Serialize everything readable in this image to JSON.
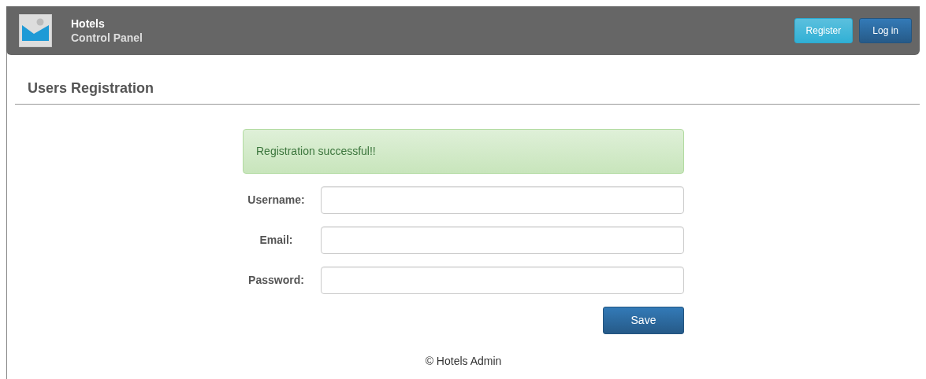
{
  "header": {
    "title": "Hotels",
    "subtitle": "Control Panel",
    "buttons": [
      {
        "label": "Register",
        "kind": "info"
      },
      {
        "label": "Log in",
        "kind": "primary"
      }
    ]
  },
  "page_title": "Users Registration",
  "alert": {
    "kind": "success",
    "text": "Registration successful!!"
  },
  "fields": [
    {
      "label": "Username:"
    },
    {
      "label": "Email:"
    },
    {
      "label": "Password:"
    }
  ],
  "save_button": "Save",
  "footer": "© Hotels Admin"
}
